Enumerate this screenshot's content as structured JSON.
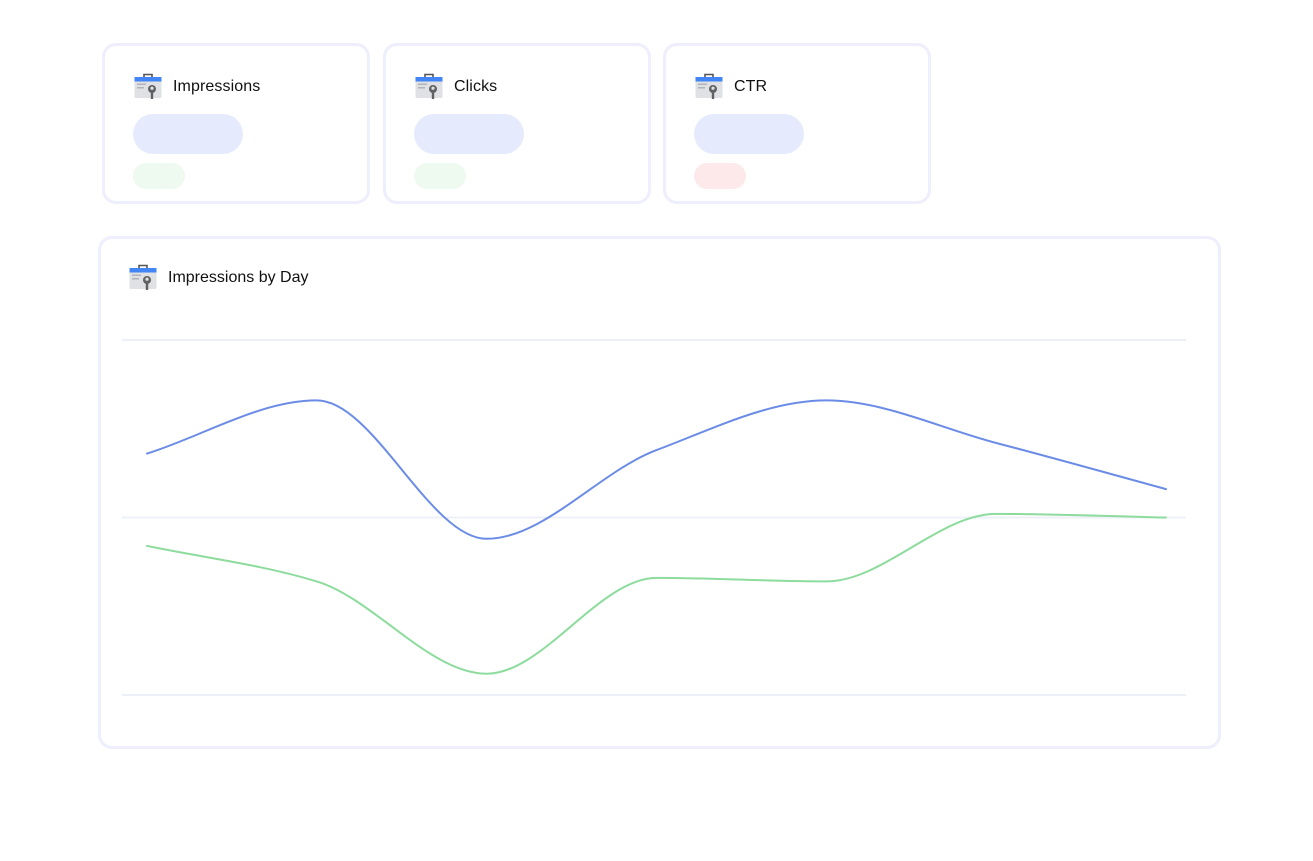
{
  "kpis": [
    {
      "title": "Impressions",
      "icon": "search-console-icon",
      "value_placeholder_color": "#e5ebfd",
      "delta_placeholder_color": "#eef9f0",
      "delta_status": "positive"
    },
    {
      "title": "Clicks",
      "icon": "search-console-icon",
      "value_placeholder_color": "#e5ebfd",
      "delta_placeholder_color": "#eef9f0",
      "delta_status": "positive"
    },
    {
      "title": "CTR",
      "icon": "search-console-icon",
      "value_placeholder_color": "#e5ebfd",
      "delta_placeholder_color": "#fde8ea",
      "delta_status": "negative"
    }
  ],
  "chart_panel": {
    "title": "Impressions by Day",
    "icon": "search-console-icon"
  },
  "chart_data": {
    "type": "line",
    "title": "Impressions by Day",
    "xlabel": "",
    "ylabel": "",
    "grid": true,
    "gridline_count": 3,
    "ylim": [
      0,
      100
    ],
    "x": [
      0,
      1,
      2,
      3,
      4,
      5,
      6
    ],
    "series": [
      {
        "color": "#6b8ce6",
        "values": [
          68,
          83,
          44,
          69,
          83,
          71,
          58
        ]
      },
      {
        "color": "#8ddc9d",
        "values": [
          42,
          32,
          6,
          33,
          32,
          51,
          50
        ]
      }
    ]
  }
}
